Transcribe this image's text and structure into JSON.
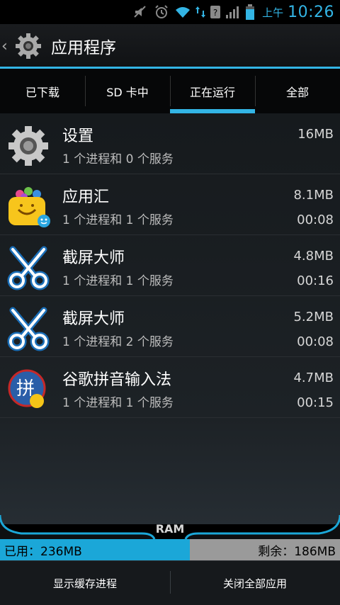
{
  "status_bar": {
    "ampm": "上午",
    "time": "10:26",
    "icons": [
      "mute-icon",
      "alarm-icon",
      "wifi-icon",
      "data-arrows-icon",
      "sim-unknown-icon",
      "signal-icon",
      "battery-icon"
    ],
    "accent_color": "#33b5e5"
  },
  "action_bar": {
    "title": "应用程序",
    "icon": "settings-gear-icon"
  },
  "tabs": [
    {
      "label": "已下载",
      "active": false
    },
    {
      "label": "SD 卡中",
      "active": false
    },
    {
      "label": "正在运行",
      "active": true
    },
    {
      "label": "全部",
      "active": false
    }
  ],
  "apps": [
    {
      "name": "设置",
      "detail": "1 个进程和 0 个服务",
      "size": "16MB",
      "time": "",
      "icon": "settings-gear-icon"
    },
    {
      "name": "应用汇",
      "detail": "1 个进程和 1 个服务",
      "size": "8.1MB",
      "time": "00:08",
      "icon": "appchina-bag-icon"
    },
    {
      "name": "截屏大师",
      "detail": "1 个进程和 1 个服务",
      "size": "4.8MB",
      "time": "00:16",
      "icon": "scissors-icon"
    },
    {
      "name": "截屏大师",
      "detail": "1 个进程和 2 个服务",
      "size": "5.2MB",
      "time": "00:08",
      "icon": "scissors-icon"
    },
    {
      "name": "谷歌拼音输入法",
      "detail": "1 个进程和 1 个服务",
      "size": "4.7MB",
      "time": "00:15",
      "icon": "pinyin-ime-icon"
    }
  ],
  "ram": {
    "label": "RAM",
    "used_text": "已用：236MB",
    "free_text": "剩余：186MB",
    "used_fraction": 0.559
  },
  "buttons": {
    "show_cached": "显示缓存进程",
    "close_all": "关闭全部应用"
  }
}
